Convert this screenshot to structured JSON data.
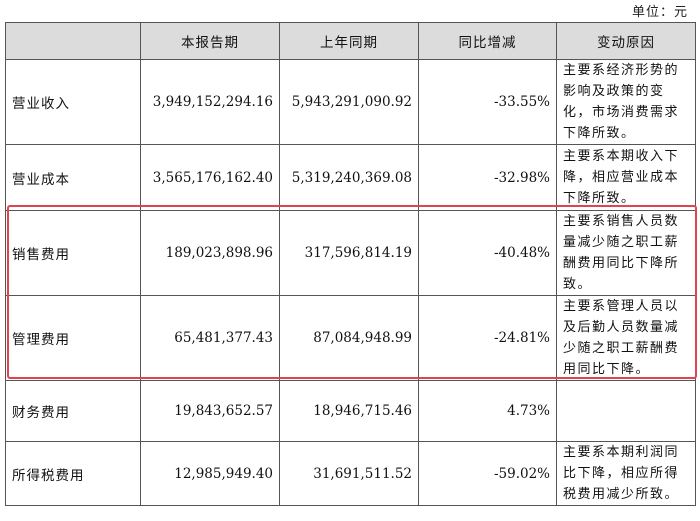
{
  "unit_label": "单位：元",
  "headers": [
    "",
    "本报告期",
    "上年同期",
    "同比增减",
    "变动原因"
  ],
  "rows": [
    {
      "item": "营业收入",
      "current": "3,949,152,294.16",
      "prior": "5,943,291,090.92",
      "change": "-33.55%",
      "reason": "主要系经济形势的影响及政策的变化，市场消费需求下降所致。"
    },
    {
      "item": "营业成本",
      "current": "3,565,176,162.40",
      "prior": "5,319,240,369.08",
      "change": "-32.98%",
      "reason": "主要系本期收入下降，相应营业成本下降所致。"
    },
    {
      "item": "销售费用",
      "current": "189,023,898.96",
      "prior": "317,596,814.19",
      "change": "-40.48%",
      "reason": "主要系销售人员数量减少随之职工薪酬费用同比下降所致。"
    },
    {
      "item": "管理费用",
      "current": "65,481,377.43",
      "prior": "87,084,948.99",
      "change": "-24.81%",
      "reason": "主要系管理人员以及后勤人员数量减少随之职工薪酬费用同比下降。"
    },
    {
      "item": "财务费用",
      "current": "19,843,652.57",
      "prior": "18,946,715.46",
      "change": "4.73%",
      "reason": ""
    },
    {
      "item": "所得税费用",
      "current": "12,985,949.40",
      "prior": "31,691,511.52",
      "change": "-59.02%",
      "reason": "主要系本期利润同比下降，相应所得税费用减少所致。"
    }
  ],
  "highlight_color": "#e0444f",
  "header_bg": "#dcdcdc"
}
